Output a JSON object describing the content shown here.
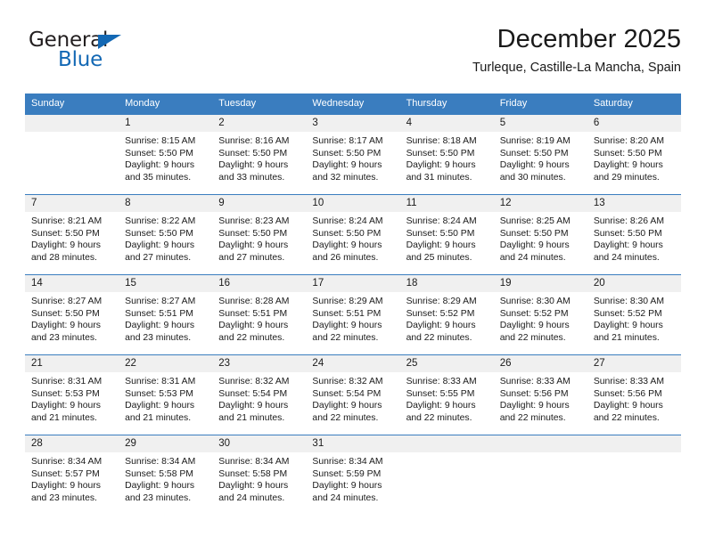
{
  "brand": {
    "name_part1": "General",
    "name_part2": "Blue",
    "logo_icon": "triangle-logo-icon"
  },
  "header": {
    "title": "December 2025",
    "subtitle": "Turleque, Castille-La Mancha, Spain"
  },
  "colors": {
    "header_blue": "#3a7dbf",
    "brand_blue": "#1368b4",
    "daynum_band": "#f0f0f0",
    "text": "#1a1a1a"
  },
  "weekday_headers": [
    "Sunday",
    "Monday",
    "Tuesday",
    "Wednesday",
    "Thursday",
    "Friday",
    "Saturday"
  ],
  "weeks": [
    [
      {
        "day": "",
        "empty": true,
        "sunrise": "",
        "sunset": "",
        "daylight_line1": "",
        "daylight_line2": ""
      },
      {
        "day": "1",
        "sunrise": "Sunrise: 8:15 AM",
        "sunset": "Sunset: 5:50 PM",
        "daylight_line1": "Daylight: 9 hours",
        "daylight_line2": "and 35 minutes."
      },
      {
        "day": "2",
        "sunrise": "Sunrise: 8:16 AM",
        "sunset": "Sunset: 5:50 PM",
        "daylight_line1": "Daylight: 9 hours",
        "daylight_line2": "and 33 minutes."
      },
      {
        "day": "3",
        "sunrise": "Sunrise: 8:17 AM",
        "sunset": "Sunset: 5:50 PM",
        "daylight_line1": "Daylight: 9 hours",
        "daylight_line2": "and 32 minutes."
      },
      {
        "day": "4",
        "sunrise": "Sunrise: 8:18 AM",
        "sunset": "Sunset: 5:50 PM",
        "daylight_line1": "Daylight: 9 hours",
        "daylight_line2": "and 31 minutes."
      },
      {
        "day": "5",
        "sunrise": "Sunrise: 8:19 AM",
        "sunset": "Sunset: 5:50 PM",
        "daylight_line1": "Daylight: 9 hours",
        "daylight_line2": "and 30 minutes."
      },
      {
        "day": "6",
        "sunrise": "Sunrise: 8:20 AM",
        "sunset": "Sunset: 5:50 PM",
        "daylight_line1": "Daylight: 9 hours",
        "daylight_line2": "and 29 minutes."
      }
    ],
    [
      {
        "day": "7",
        "sunrise": "Sunrise: 8:21 AM",
        "sunset": "Sunset: 5:50 PM",
        "daylight_line1": "Daylight: 9 hours",
        "daylight_line2": "and 28 minutes."
      },
      {
        "day": "8",
        "sunrise": "Sunrise: 8:22 AM",
        "sunset": "Sunset: 5:50 PM",
        "daylight_line1": "Daylight: 9 hours",
        "daylight_line2": "and 27 minutes."
      },
      {
        "day": "9",
        "sunrise": "Sunrise: 8:23 AM",
        "sunset": "Sunset: 5:50 PM",
        "daylight_line1": "Daylight: 9 hours",
        "daylight_line2": "and 27 minutes."
      },
      {
        "day": "10",
        "sunrise": "Sunrise: 8:24 AM",
        "sunset": "Sunset: 5:50 PM",
        "daylight_line1": "Daylight: 9 hours",
        "daylight_line2": "and 26 minutes."
      },
      {
        "day": "11",
        "sunrise": "Sunrise: 8:24 AM",
        "sunset": "Sunset: 5:50 PM",
        "daylight_line1": "Daylight: 9 hours",
        "daylight_line2": "and 25 minutes."
      },
      {
        "day": "12",
        "sunrise": "Sunrise: 8:25 AM",
        "sunset": "Sunset: 5:50 PM",
        "daylight_line1": "Daylight: 9 hours",
        "daylight_line2": "and 24 minutes."
      },
      {
        "day": "13",
        "sunrise": "Sunrise: 8:26 AM",
        "sunset": "Sunset: 5:50 PM",
        "daylight_line1": "Daylight: 9 hours",
        "daylight_line2": "and 24 minutes."
      }
    ],
    [
      {
        "day": "14",
        "sunrise": "Sunrise: 8:27 AM",
        "sunset": "Sunset: 5:50 PM",
        "daylight_line1": "Daylight: 9 hours",
        "daylight_line2": "and 23 minutes."
      },
      {
        "day": "15",
        "sunrise": "Sunrise: 8:27 AM",
        "sunset": "Sunset: 5:51 PM",
        "daylight_line1": "Daylight: 9 hours",
        "daylight_line2": "and 23 minutes."
      },
      {
        "day": "16",
        "sunrise": "Sunrise: 8:28 AM",
        "sunset": "Sunset: 5:51 PM",
        "daylight_line1": "Daylight: 9 hours",
        "daylight_line2": "and 22 minutes."
      },
      {
        "day": "17",
        "sunrise": "Sunrise: 8:29 AM",
        "sunset": "Sunset: 5:51 PM",
        "daylight_line1": "Daylight: 9 hours",
        "daylight_line2": "and 22 minutes."
      },
      {
        "day": "18",
        "sunrise": "Sunrise: 8:29 AM",
        "sunset": "Sunset: 5:52 PM",
        "daylight_line1": "Daylight: 9 hours",
        "daylight_line2": "and 22 minutes."
      },
      {
        "day": "19",
        "sunrise": "Sunrise: 8:30 AM",
        "sunset": "Sunset: 5:52 PM",
        "daylight_line1": "Daylight: 9 hours",
        "daylight_line2": "and 22 minutes."
      },
      {
        "day": "20",
        "sunrise": "Sunrise: 8:30 AM",
        "sunset": "Sunset: 5:52 PM",
        "daylight_line1": "Daylight: 9 hours",
        "daylight_line2": "and 21 minutes."
      }
    ],
    [
      {
        "day": "21",
        "sunrise": "Sunrise: 8:31 AM",
        "sunset": "Sunset: 5:53 PM",
        "daylight_line1": "Daylight: 9 hours",
        "daylight_line2": "and 21 minutes."
      },
      {
        "day": "22",
        "sunrise": "Sunrise: 8:31 AM",
        "sunset": "Sunset: 5:53 PM",
        "daylight_line1": "Daylight: 9 hours",
        "daylight_line2": "and 21 minutes."
      },
      {
        "day": "23",
        "sunrise": "Sunrise: 8:32 AM",
        "sunset": "Sunset: 5:54 PM",
        "daylight_line1": "Daylight: 9 hours",
        "daylight_line2": "and 21 minutes."
      },
      {
        "day": "24",
        "sunrise": "Sunrise: 8:32 AM",
        "sunset": "Sunset: 5:54 PM",
        "daylight_line1": "Daylight: 9 hours",
        "daylight_line2": "and 22 minutes."
      },
      {
        "day": "25",
        "sunrise": "Sunrise: 8:33 AM",
        "sunset": "Sunset: 5:55 PM",
        "daylight_line1": "Daylight: 9 hours",
        "daylight_line2": "and 22 minutes."
      },
      {
        "day": "26",
        "sunrise": "Sunrise: 8:33 AM",
        "sunset": "Sunset: 5:56 PM",
        "daylight_line1": "Daylight: 9 hours",
        "daylight_line2": "and 22 minutes."
      },
      {
        "day": "27",
        "sunrise": "Sunrise: 8:33 AM",
        "sunset": "Sunset: 5:56 PM",
        "daylight_line1": "Daylight: 9 hours",
        "daylight_line2": "and 22 minutes."
      }
    ],
    [
      {
        "day": "28",
        "sunrise": "Sunrise: 8:34 AM",
        "sunset": "Sunset: 5:57 PM",
        "daylight_line1": "Daylight: 9 hours",
        "daylight_line2": "and 23 minutes."
      },
      {
        "day": "29",
        "sunrise": "Sunrise: 8:34 AM",
        "sunset": "Sunset: 5:58 PM",
        "daylight_line1": "Daylight: 9 hours",
        "daylight_line2": "and 23 minutes."
      },
      {
        "day": "30",
        "sunrise": "Sunrise: 8:34 AM",
        "sunset": "Sunset: 5:58 PM",
        "daylight_line1": "Daylight: 9 hours",
        "daylight_line2": "and 24 minutes."
      },
      {
        "day": "31",
        "sunrise": "Sunrise: 8:34 AM",
        "sunset": "Sunset: 5:59 PM",
        "daylight_line1": "Daylight: 9 hours",
        "daylight_line2": "and 24 minutes."
      },
      {
        "day": "",
        "empty": true,
        "sunrise": "",
        "sunset": "",
        "daylight_line1": "",
        "daylight_line2": ""
      },
      {
        "day": "",
        "empty": true,
        "sunrise": "",
        "sunset": "",
        "daylight_line1": "",
        "daylight_line2": ""
      },
      {
        "day": "",
        "empty": true,
        "sunrise": "",
        "sunset": "",
        "daylight_line1": "",
        "daylight_line2": ""
      }
    ]
  ]
}
